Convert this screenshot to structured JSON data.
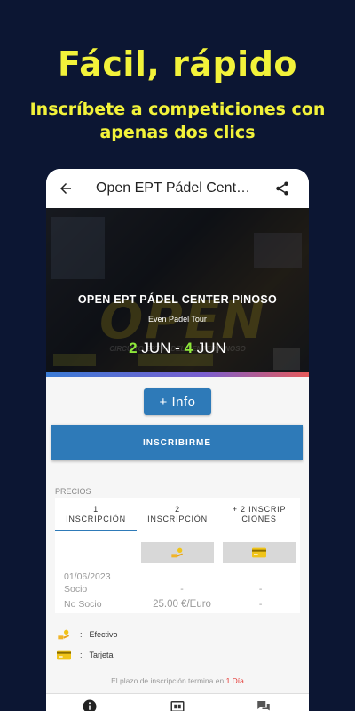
{
  "promo": {
    "title": "Fácil, rápido",
    "subtitle": "Inscríbete a competiciones con apenas dos clics"
  },
  "appbar": {
    "title": "Open EPT Pádel Center Pinoso",
    "back_icon": "arrow-back-icon",
    "share_icon": "share-icon"
  },
  "event": {
    "title": "OPEN EPT PÁDEL CENTER PINOSO",
    "organizer": "Even Padel Tour",
    "start_day": "2",
    "start_month": "JUN",
    "end_day": "4",
    "end_month": "JUN",
    "separator": "-",
    "banner_big_text": "OPEN",
    "banner_circuit_text": "CIRCUITO EPT PADEL CENTER PINOSO"
  },
  "buttons": {
    "info": "+ Info",
    "inscribirme": "INSCRIBIRME"
  },
  "prices": {
    "section_label": "PRECIOS",
    "tabs": [
      {
        "line1": "1",
        "line2": "INSCRIPCIÓN"
      },
      {
        "line1": "2",
        "line2": "INSCRIPCIÓN"
      },
      {
        "line1": "+ 2 INSCRIP",
        "line2": "CIONES"
      }
    ],
    "active_tab": 0,
    "rows": [
      {
        "label": "01/06/2023",
        "col2": "",
        "col3": ""
      },
      {
        "label": "Socio",
        "col2": "-",
        "col3": "-"
      },
      {
        "label": "No Socio",
        "col2": "25.00 €/Euro",
        "col3": "-"
      }
    ]
  },
  "legend": {
    "cash_label": "Efectivo",
    "card_label": "Tarjeta",
    "separator": ":"
  },
  "deadline": {
    "text": "El plazo de inscripción termina en",
    "highlight": "1 Día"
  },
  "colors": {
    "background": "#0c1633",
    "accent_yellow": "#f2f23a",
    "primary_blue": "#2e7ab8",
    "date_green": "#8ee83a",
    "deadline_red": "#e53935"
  }
}
